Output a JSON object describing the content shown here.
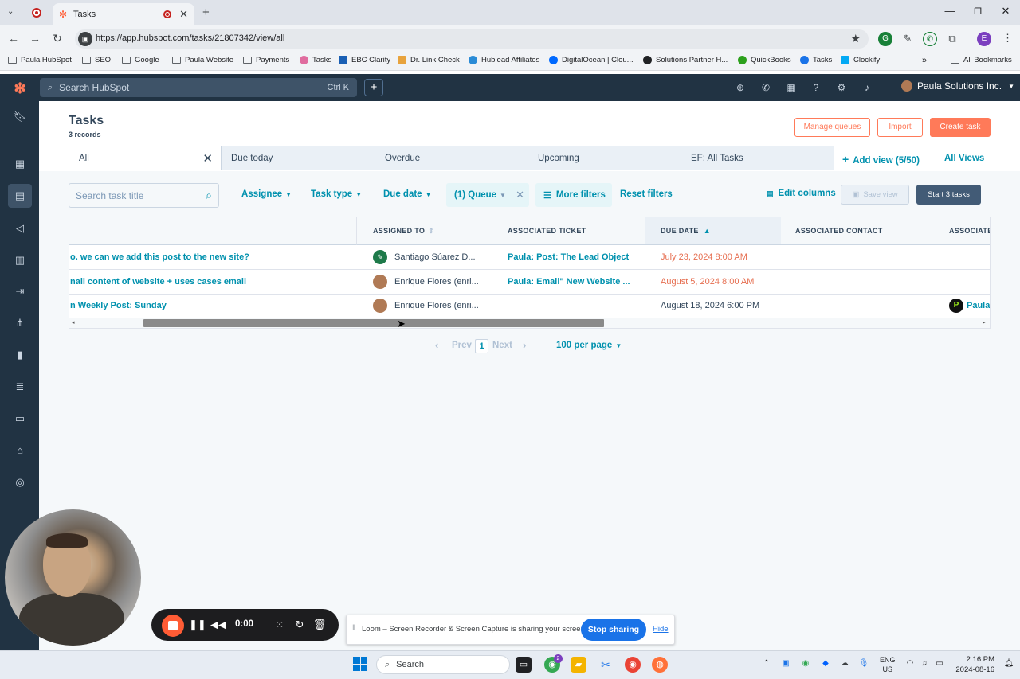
{
  "browser": {
    "tab_title": "Tasks",
    "url": "https://app.hubspot.com/tasks/21807342/view/all",
    "bookmarks": [
      "Paula HubSpot",
      "SEO",
      "Google",
      "Paula Website",
      "Payments",
      "Tasks",
      "EBC Clarity",
      "Dr. Link Check",
      "Hublead Affiliates",
      "DigitalOcean | Clou...",
      "Solutions Partner H...",
      "QuickBooks",
      "Tasks",
      "Clockify"
    ],
    "all_bookmarks": "All Bookmarks",
    "more": "»",
    "profile_initial": "E"
  },
  "hubspot_nav": {
    "search_placeholder": "Search HubSpot",
    "search_shortcut": "Ctrl K",
    "account_name": "Paula Solutions Inc."
  },
  "page": {
    "title": "Tasks",
    "record_count": "3 records",
    "manage_queues": "Manage queues",
    "import": "Import",
    "create_task": "Create task"
  },
  "views": {
    "tabs": [
      {
        "label": "All"
      },
      {
        "label": "Due today"
      },
      {
        "label": "Overdue"
      },
      {
        "label": "Upcoming"
      },
      {
        "label": "EF: All Tasks"
      }
    ],
    "add_view": "Add view (5/50)",
    "all_views": "All Views"
  },
  "filters": {
    "search_placeholder": "Search task title",
    "assignee": "Assignee",
    "task_type": "Task type",
    "due_date": "Due date",
    "queue": "(1) Queue",
    "more_filters": "More filters",
    "reset": "Reset filters",
    "edit_columns": "Edit columns",
    "save_view": "Save view",
    "start_tasks": "Start 3 tasks"
  },
  "table": {
    "columns": [
      "ASSIGNED TO",
      "ASSOCIATED TICKET",
      "DUE DATE",
      "ASSOCIATED CONTACT",
      "ASSOCIATE"
    ],
    "rows": [
      {
        "title": "o. we can we add this post to the new site?",
        "assignee": "Santiago Súarez D...",
        "ticket": "Paula: Post: The Lead Object",
        "due": "July 23, 2024 8:00 AM",
        "overdue": true,
        "contact": "",
        "assoc": ""
      },
      {
        "title": "nail content of website + uses cases email",
        "assignee": "Enrique Flores (enri...",
        "ticket": "Paula: Email\" New Website ...",
        "due": "August 5, 2024 8:00 AM",
        "overdue": true,
        "contact": "",
        "assoc": ""
      },
      {
        "title": "n Weekly Post: Sunday",
        "assignee": "Enrique Flores (enri...",
        "ticket": "",
        "due": "August 18, 2024 6:00 PM",
        "overdue": false,
        "contact": "",
        "assoc": "Paula"
      }
    ]
  },
  "pagination": {
    "prev": "Prev",
    "page": "1",
    "next": "Next",
    "per_page": "100 per page"
  },
  "loom": {
    "timer": "0:00",
    "share_text": "Loom – Screen Recorder & Screen Capture is sharing your screen.",
    "stop_sharing": "Stop sharing",
    "hide": "Hide"
  },
  "taskbar": {
    "search": "Search",
    "lang_line1": "ENG",
    "lang_line2": "US",
    "time": "2:16 PM",
    "date": "2024-08-16",
    "chrome_badge": "2"
  },
  "colors": {
    "hubspot_nav": "#213343",
    "accent_orange": "#ff7a59",
    "link_teal": "#0091ae",
    "overdue_red": "#e66e50",
    "loom_orange": "#ff5c35"
  }
}
